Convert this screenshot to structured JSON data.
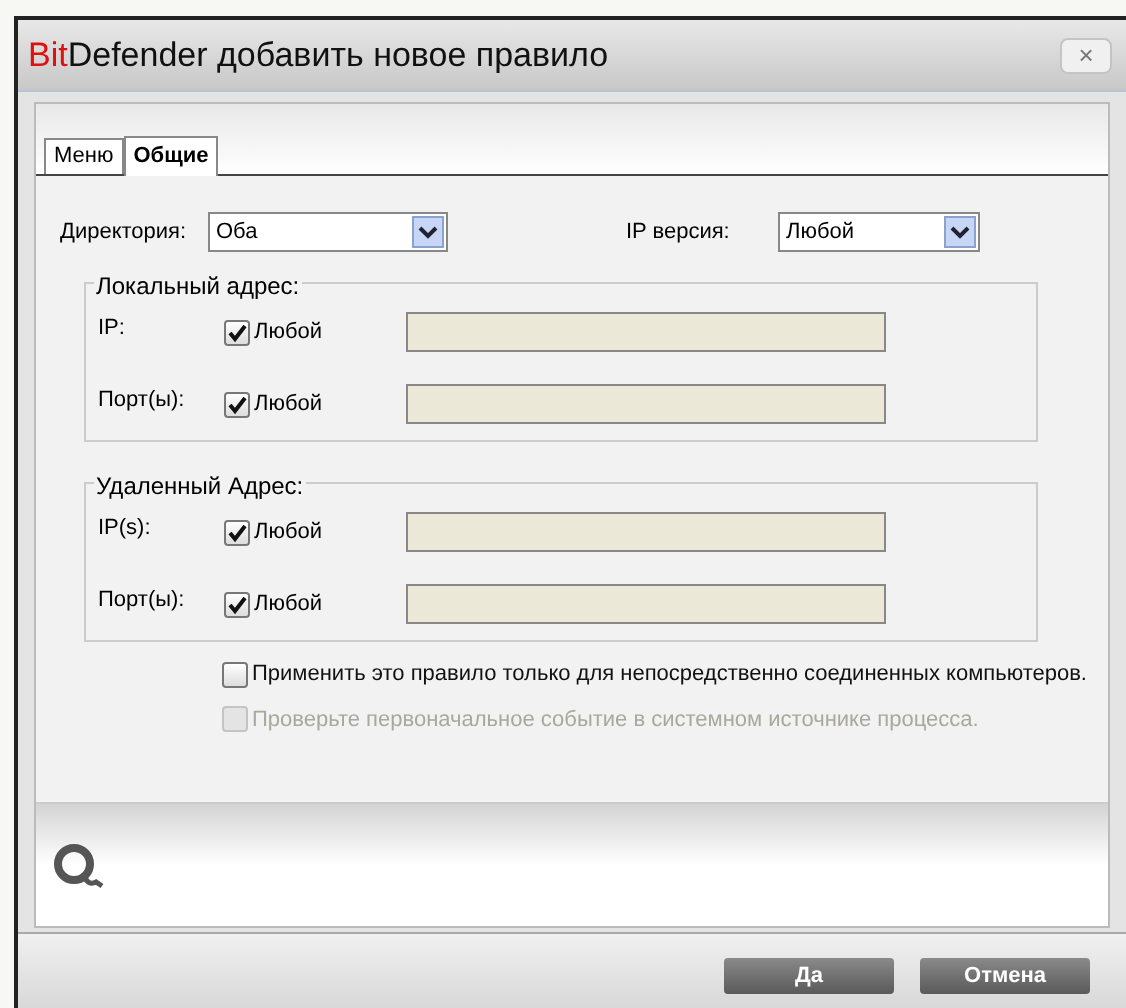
{
  "window": {
    "title_brand": "Bit",
    "title": "Defender добавить новое правило",
    "close": "×"
  },
  "tabs": [
    {
      "label": "Меню",
      "selected": false
    },
    {
      "label": "Общие",
      "selected": true
    }
  ],
  "selects": [
    {
      "label": "Директория:",
      "value": "Оба"
    },
    {
      "label": "IP версия:",
      "value": "Любой"
    }
  ],
  "groups": [
    {
      "legend": "Локальный адрес:",
      "rows": [
        {
          "label": "IP:",
          "checkbox_label": "Любой",
          "checked": true
        },
        {
          "label": "Порт(ы):",
          "checkbox_label": "Любой",
          "checked": true
        }
      ]
    },
    {
      "legend": "Удаленный Адрес:",
      "rows": [
        {
          "label": "IP(s):",
          "checkbox_label": "Любой",
          "checked": true
        },
        {
          "label": "Порт(ы):",
          "checkbox_label": "Любой",
          "checked": true
        }
      ]
    }
  ],
  "options": [
    {
      "label": "Применить это правило только для непосредственно соединенных компьютеров.",
      "checked": false,
      "disabled": false
    },
    {
      "label": "Проверьте первоначальное событие в системном источнике процесса.",
      "checked": false,
      "disabled": true
    }
  ],
  "buttons": [
    "Да",
    "Отмена"
  ]
}
